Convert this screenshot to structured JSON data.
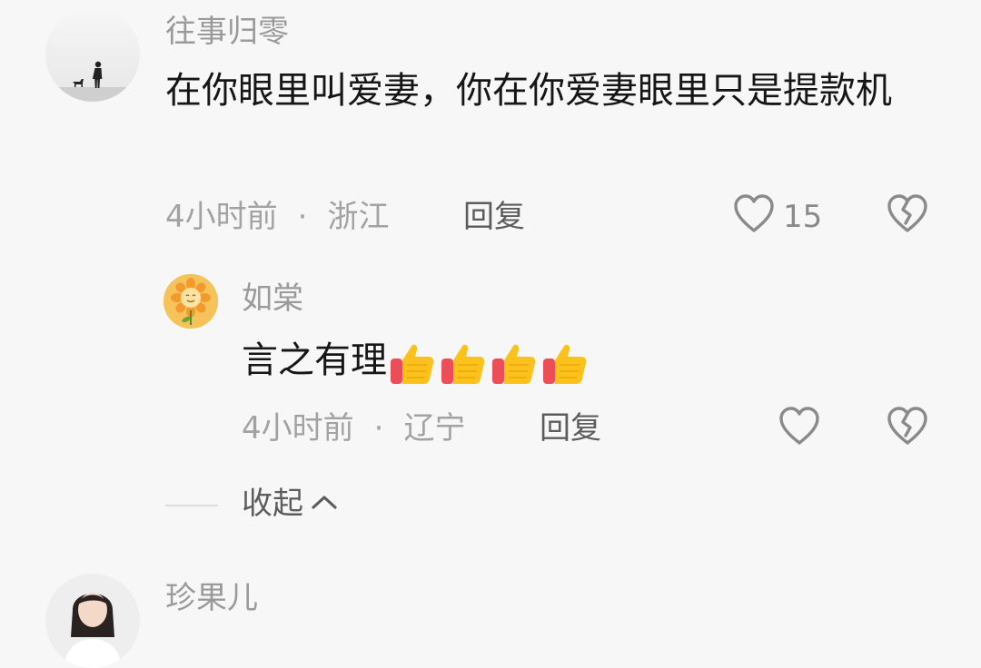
{
  "comments": [
    {
      "username": "往事归零",
      "text": "在你眼里叫爱妻，你在你爱妻眼里只是提款机",
      "time": "4小时前",
      "separator": "·",
      "location": "浙江",
      "reply_label": "回复",
      "like_count": "15",
      "icons": {
        "like": "heart-outline-icon",
        "dislike": "broken-heart-icon"
      }
    },
    {
      "username": "如棠",
      "text": "言之有理",
      "emoji": [
        "thumbs-up",
        "thumbs-up",
        "thumbs-up",
        "thumbs-up"
      ],
      "time": "4小时前",
      "separator": "·",
      "location": "辽宁",
      "reply_label": "回复",
      "icons": {
        "like": "heart-outline-icon",
        "dislike": "broken-heart-icon"
      }
    },
    {
      "username": "珍果儿"
    }
  ],
  "collapse": {
    "label": "收起",
    "icon": "chevron-up-icon"
  },
  "colors": {
    "background": "#f7f7f7",
    "text": "#161616",
    "muted": "#a2a2a2",
    "reply": "#5c5c5c",
    "icon": "#8a8a8a"
  }
}
